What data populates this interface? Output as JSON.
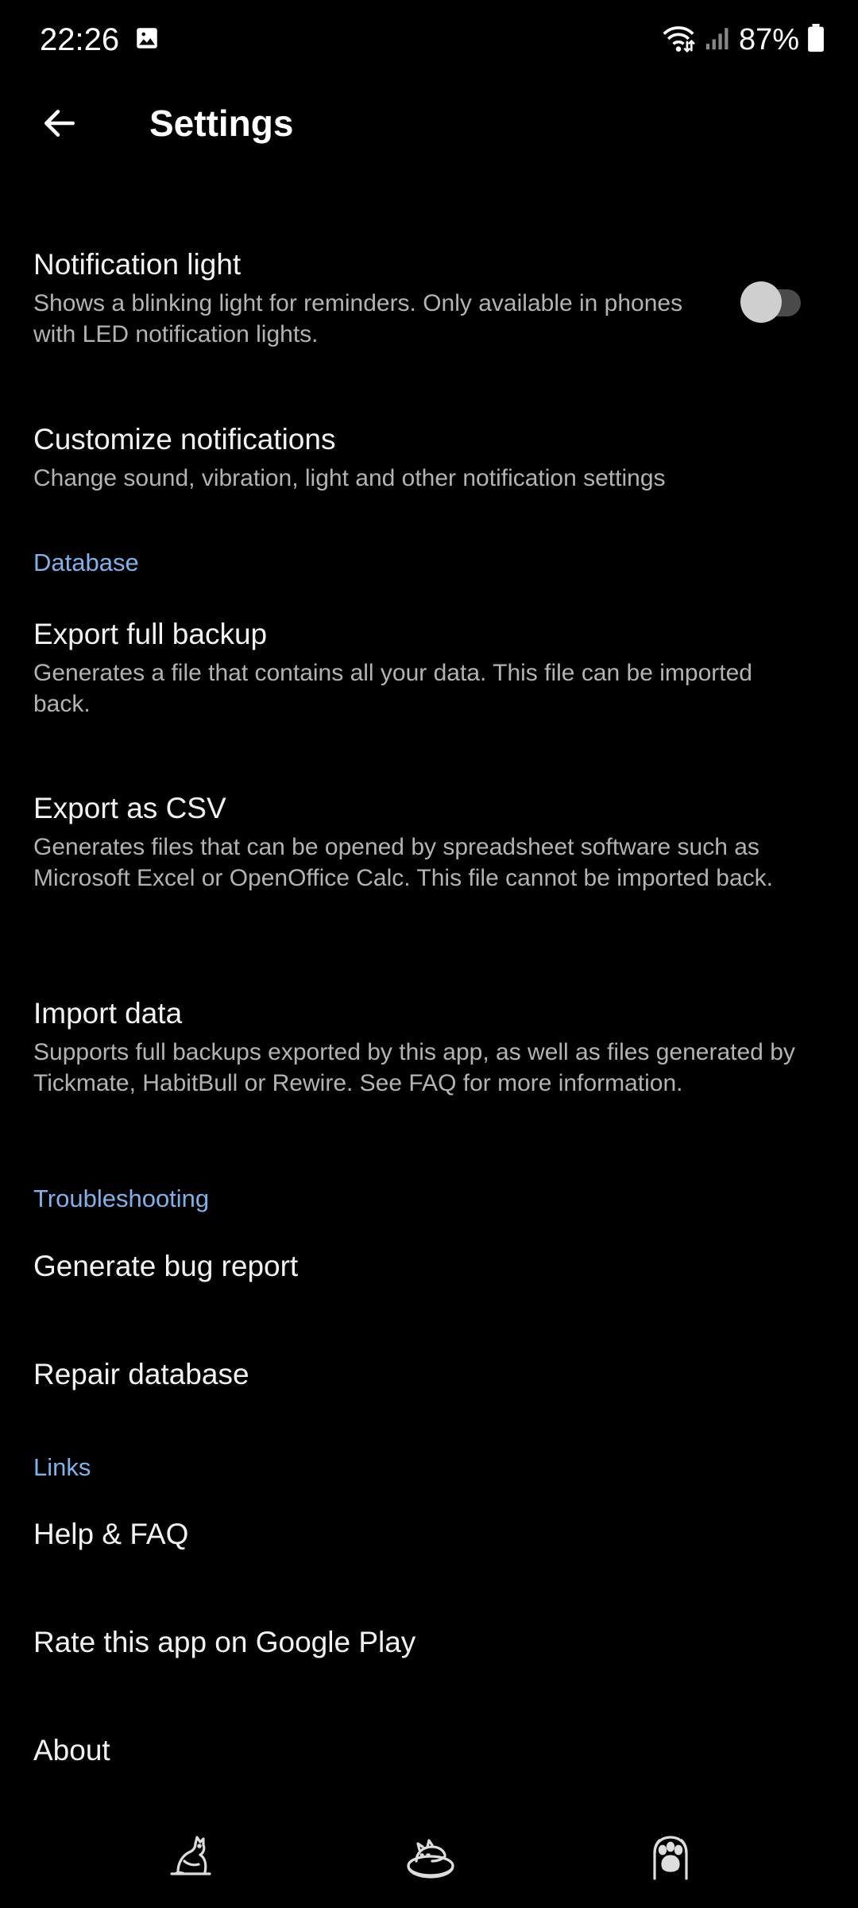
{
  "status_bar": {
    "time": "22:26",
    "battery": "87%",
    "icons": [
      "gallery-icon",
      "wifi-icon",
      "signal-icon",
      "battery-icon"
    ]
  },
  "toolbar": {
    "back_icon": "arrow-left-icon",
    "title": "Settings"
  },
  "notification_light": {
    "title": "Notification light",
    "description": "Shows a blinking light for reminders. Only available in phones with LED notification lights.",
    "toggle_on": false
  },
  "customize_notifications": {
    "title": "Customize notifications",
    "description": "Change sound, vibration, light and other notification settings"
  },
  "database": {
    "header": "Database",
    "export_backup": {
      "title": "Export full backup",
      "description": "Generates a file that contains all your data. This file can be imported back."
    },
    "export_csv": {
      "title": "Export as CSV",
      "description": "Generates files that can be opened by spreadsheet software such as Microsoft Excel or OpenOffice Calc. This file cannot be imported back."
    },
    "import_data": {
      "title": "Import data",
      "description": "Supports full backups exported by this app, as well as files generated by Tickmate, HabitBull or Rewire. See FAQ for more information."
    }
  },
  "troubleshooting": {
    "header": "Troubleshooting",
    "bug_report": "Generate bug report",
    "repair_database": "Repair database"
  },
  "links": {
    "header": "Links",
    "help_faq": "Help & FAQ",
    "rate_app": "Rate this app on Google Play",
    "about": "About"
  },
  "bottom_nav": {
    "icons": [
      "cat-stretching-icon",
      "cat-in-bed-icon",
      "paw-icon"
    ]
  },
  "colors": {
    "background": "#000000",
    "accent": "#7fb2ea",
    "text_primary": "#f2f2f2",
    "text_secondary": "#b3b3b3"
  }
}
